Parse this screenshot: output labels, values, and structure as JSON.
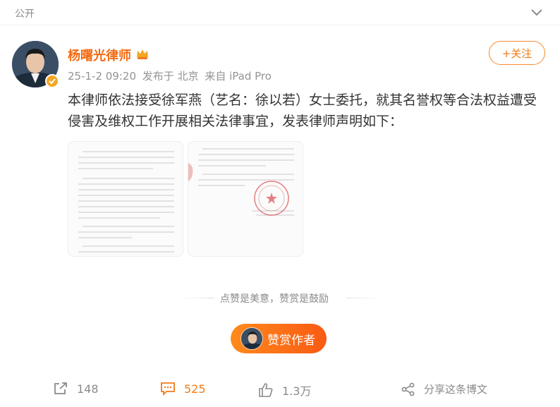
{
  "header": {
    "visibility": "公开"
  },
  "post": {
    "author": "杨曙光律师",
    "meta": {
      "time": "25-1-2 09:20",
      "location": "发布于 北京",
      "source": "来自 iPad Pro"
    },
    "follow_label": "+关注",
    "content": "本律师依法接受徐军燕（艺名：徐以若）女士委托，就其名誉权等合法权益遭受侵害及维权工作开展相关法律事宜，发表律师声明如下：",
    "images": [
      {
        "icon": "document-page-1"
      },
      {
        "icon": "document-page-2-with-seal"
      }
    ]
  },
  "reward": {
    "tip": "点赞是美意，赞赏是鼓励",
    "button_label": "赞赏作者"
  },
  "actions": {
    "repost_count": "148",
    "comment_count": "525",
    "like_count": "1.3万",
    "share_label": "分享这条博文"
  },
  "colors": {
    "accent": "#f27b17",
    "author": "#f36a10",
    "seal": "#d94a4a"
  }
}
